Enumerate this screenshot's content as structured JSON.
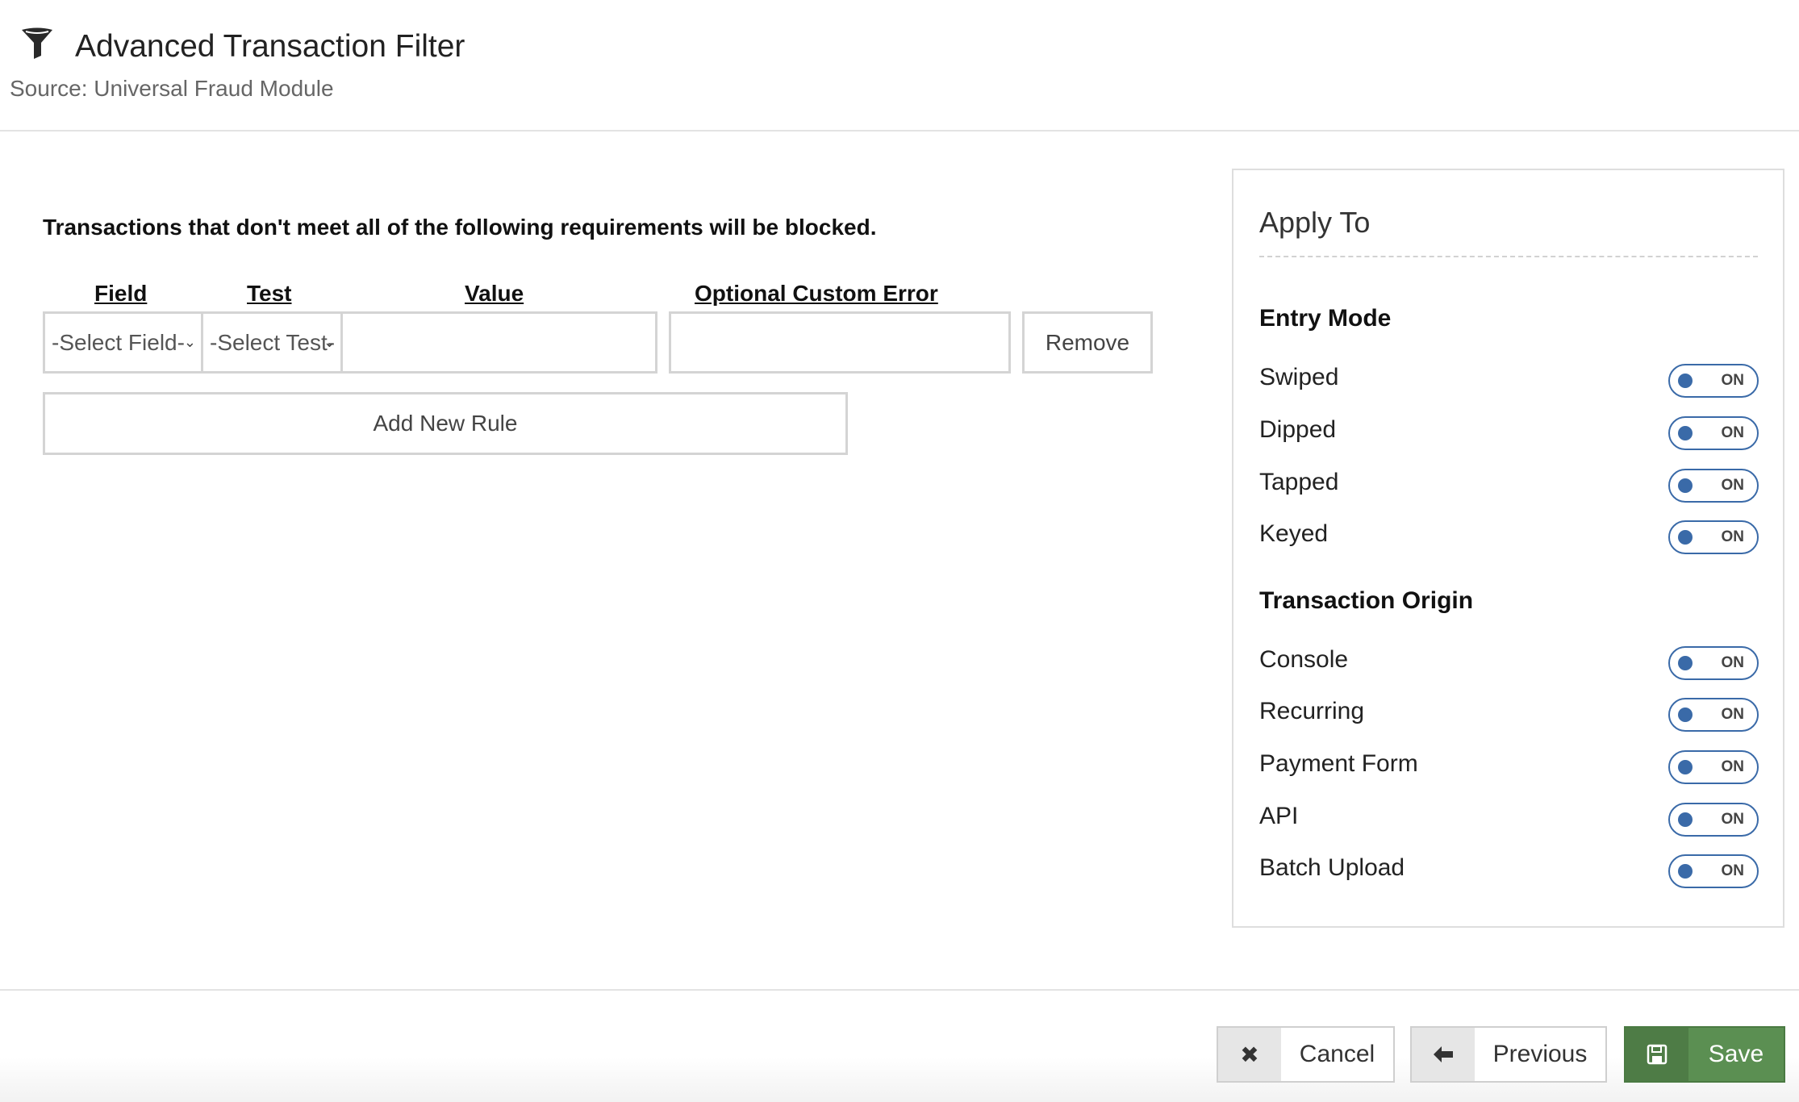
{
  "header": {
    "title": "Advanced Transaction Filter",
    "subtitle": "Source: Universal Fraud Module",
    "icon": "filter-icon"
  },
  "rules": {
    "instructions": "Transactions that don't meet all of the following requirements will be blocked.",
    "columns": {
      "field": "Field",
      "test": "Test",
      "value": "Value",
      "custom_error": "Optional Custom Error"
    },
    "row": {
      "field_select": "-Select Field-",
      "test_select": "-Select Test-",
      "value": "",
      "custom_error": "",
      "remove_label": "Remove"
    },
    "add_rule_label": "Add New Rule"
  },
  "apply_to": {
    "title": "Apply To",
    "entry_mode": {
      "heading": "Entry Mode",
      "items": [
        {
          "label": "Swiped",
          "state": "ON"
        },
        {
          "label": "Dipped",
          "state": "ON"
        },
        {
          "label": "Tapped",
          "state": "ON"
        },
        {
          "label": "Keyed",
          "state": "ON"
        }
      ]
    },
    "transaction_origin": {
      "heading": "Transaction Origin",
      "items": [
        {
          "label": "Console",
          "state": "ON"
        },
        {
          "label": "Recurring",
          "state": "ON"
        },
        {
          "label": "Payment Form",
          "state": "ON"
        },
        {
          "label": "API",
          "state": "ON"
        },
        {
          "label": "Batch Upload",
          "state": "ON"
        }
      ]
    }
  },
  "footer": {
    "cancel_label": "Cancel",
    "previous_label": "Previous",
    "save_label": "Save",
    "save_color": "#5b8f52"
  }
}
